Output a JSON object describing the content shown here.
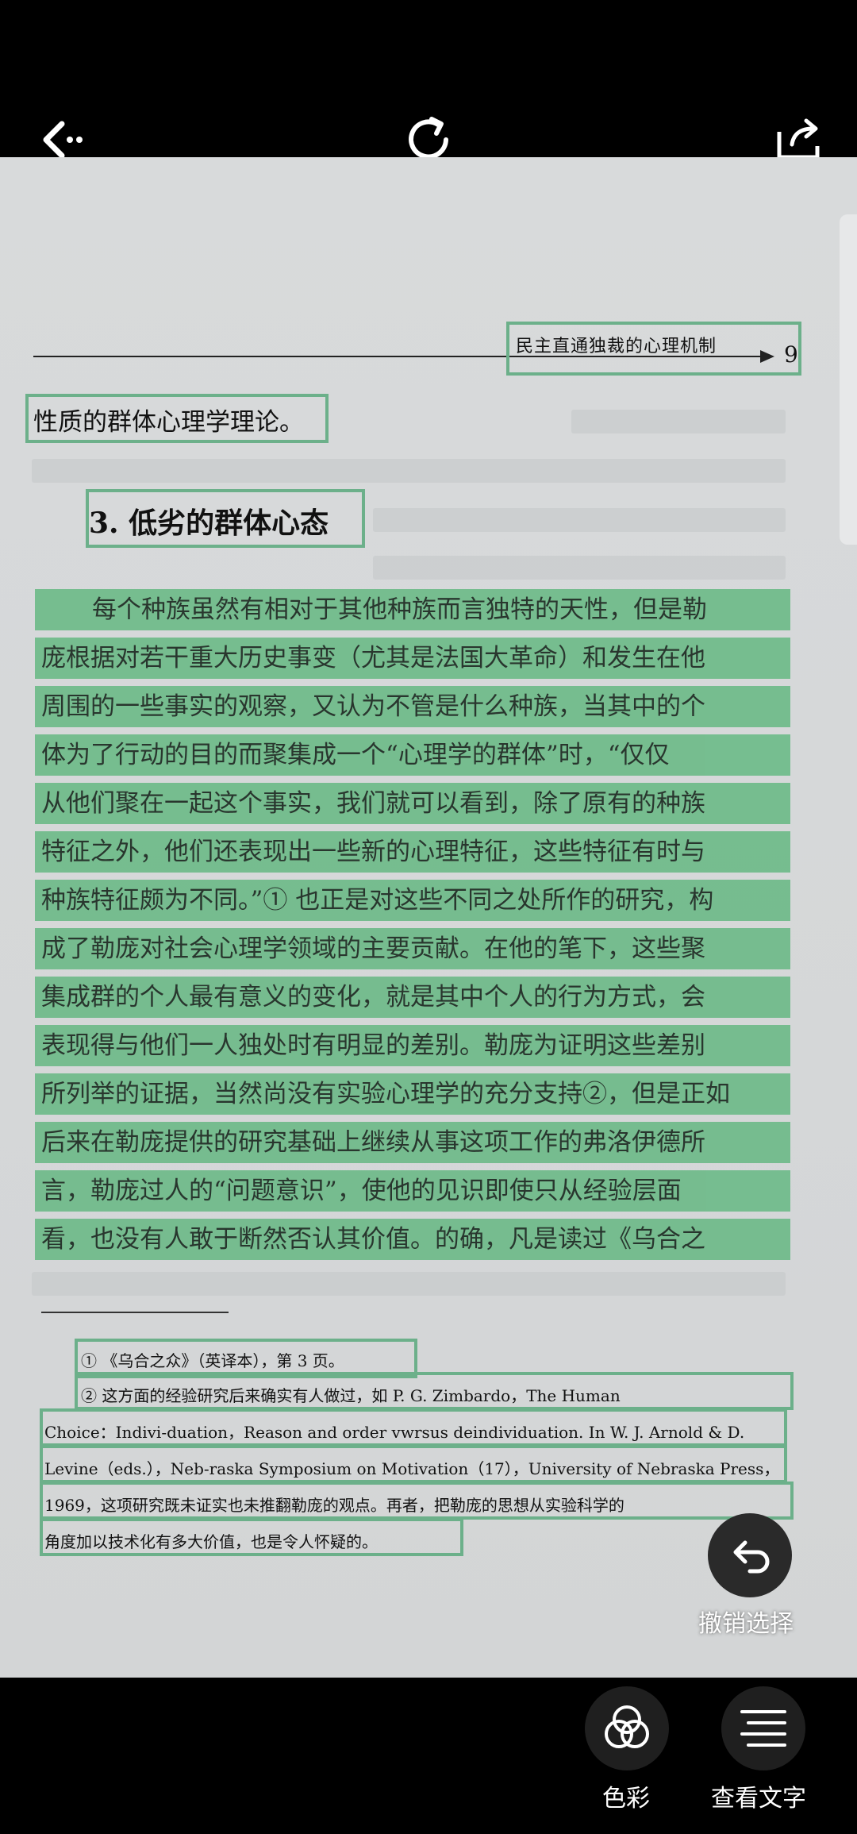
{
  "toolbar": {
    "back_icon": "back-arrow-icon",
    "rotate_icon": "rotate-icon",
    "share_icon": "share-icon"
  },
  "page": {
    "running_header": "民主直通独裁的心理机制",
    "page_number": "9",
    "prev_line": "性质的群体心理学理论。",
    "section_title": "3.  低劣的群体心态",
    "body_lines": [
      "每个种族虽然有相对于其他种族而言独特的天性，但是勒",
      "庞根据对若干重大历史事变（尤其是法国大革命）和发生在他",
      "周围的一些事实的观察，又认为不管是什么种族，当其中的个",
      "体为了行动的目的而聚集成一个“心理学的群体”时，“仅仅",
      "从他们聚在一起这个事实，我们就可以看到，除了原有的种族",
      "特征之外，他们还表现出一些新的心理特征，这些特征有时与",
      "种族特征颇为不同。”① 也正是对这些不同之处所作的研究，构",
      "成了勒庞对社会心理学领域的主要贡献。在他的笔下，这些聚",
      "集成群的个人最有意义的变化，就是其中个人的行为方式，会",
      "表现得与他们一人独处时有明显的差别。勒庞为证明这些差别",
      "所列举的证据，当然尚没有实验心理学的充分支持②，但是正如",
      "后来在勒庞提供的研究基础上继续从事这项工作的弗洛伊德所",
      "言，勒庞过人的“问题意识”，使他的见识即使只从经验层面",
      "看，也没有人敢于断然否认其价值。的确，凡是读过《乌合之"
    ],
    "footnotes": [
      "① 《乌合之众》（英译本），第 3 页。",
      "②  这方面的经验研究后来确实有人做过，如 P. G. Zimbardo，The Human",
      "Choice：Indivi-duation，Reason and order vwrsus deindividuation.  In W. J. Arnold & D.",
      "Levine（eds.），Neb-raska Symposium on Motivation（17），University of Nebraska Press，",
      "1969，这项研究既未证实也未推翻勒庞的观点。再者，把勒庞的思想从实验科学的",
      "角度加以技术化有多大价值，也是令人怀疑的。"
    ]
  },
  "actions": {
    "undo_label": "撤销选择",
    "color_label": "色彩",
    "view_text_label": "查看文字"
  },
  "colors": {
    "highlight": "#6fbb8a",
    "box_border": "#6cb08a",
    "bar": "#000000"
  }
}
